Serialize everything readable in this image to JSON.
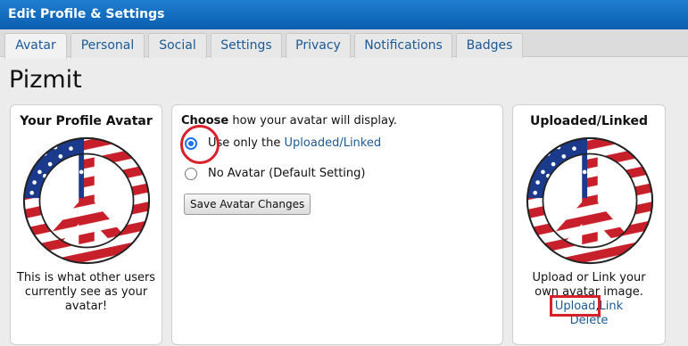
{
  "window": {
    "title": "Edit Profile & Settings"
  },
  "tabs": [
    {
      "label": "Avatar",
      "active": true
    },
    {
      "label": "Personal"
    },
    {
      "label": "Social"
    },
    {
      "label": "Settings"
    },
    {
      "label": "Privacy"
    },
    {
      "label": "Notifications"
    },
    {
      "label": "Badges"
    }
  ],
  "page": {
    "title": "Pizmit"
  },
  "current_avatar": {
    "heading": "Your Profile Avatar",
    "caption": "This is what other users currently see as your avatar!"
  },
  "display_options": {
    "choose_bold": "Choose",
    "choose_rest": " how your avatar will display.",
    "option1_prefix": "Use only the ",
    "option1_link": "Uploaded/Linked",
    "option1_checked": true,
    "option2_label": "No Avatar (Default Setting)",
    "save_label": "Save Avatar Changes"
  },
  "uploaded": {
    "heading": "Uploaded/Linked",
    "caption": "Upload or Link your own avatar image.",
    "upload_label": "Upload",
    "separator": ",",
    "link_label": "Link",
    "delete_label": "Delete"
  },
  "colors": {
    "title_bar": "#0c5eb0",
    "link": "#1a5a96",
    "highlight": "#d8202a",
    "flag_red": "#c8202a",
    "flag_blue": "#1b3a8c"
  },
  "icons": [
    "peace-sign-flag-icon"
  ]
}
